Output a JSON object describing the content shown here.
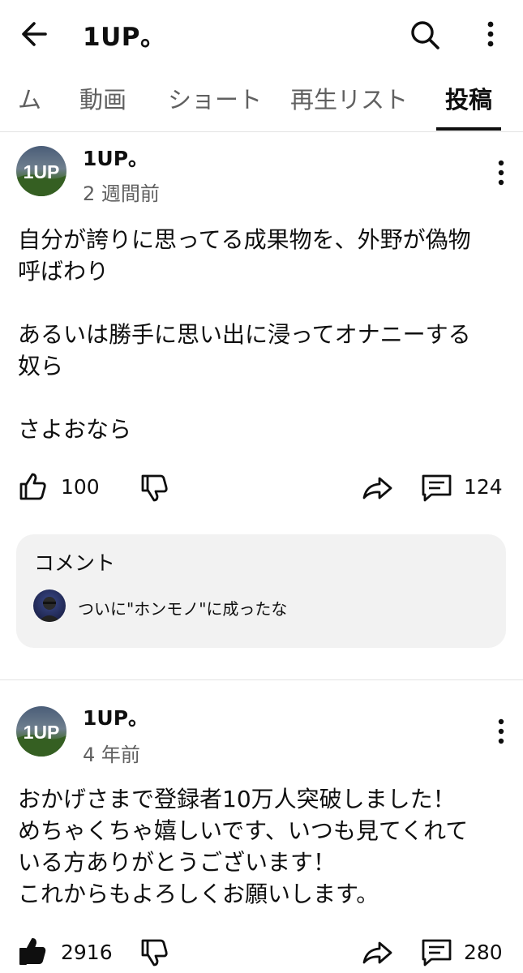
{
  "header": {
    "title": "1UP。",
    "back_icon": "arrow-left-icon",
    "search_icon": "search-icon",
    "more_icon": "more-vertical-icon"
  },
  "tabs": [
    {
      "label": "ム",
      "active": false
    },
    {
      "label": "動画",
      "active": false
    },
    {
      "label": "ショート",
      "active": false
    },
    {
      "label": "再生リスト",
      "active": false
    },
    {
      "label": "投稿",
      "active": true
    }
  ],
  "posts": [
    {
      "author": "1UP。",
      "time": "2 週間前",
      "text": "自分が誇りに思ってる成果物を、外野が偽物\n呼ばわり\n\nあるいは勝手に思い出に浸ってオナニーする\n奴ら\n\nさよおなら",
      "likes": "100",
      "comments": "124",
      "comment_preview": {
        "heading": "コメント",
        "text": "ついに\"ホンモノ\"に成ったな"
      }
    },
    {
      "author": "1UP。",
      "time": "4 年前",
      "text": "おかげさまで登録者10万人突破しました！\nめちゃくちゃ嬉しいです、いつも見てくれて\nいる方ありがとうございます！\nこれからもよろしくお願いします。",
      "likes": "2916",
      "comments": "280"
    }
  ],
  "colors": {
    "text_primary": "#0f0f0f",
    "text_secondary": "#606060",
    "comment_bg": "#f2f2f2",
    "divider": "#e3e3e3"
  }
}
